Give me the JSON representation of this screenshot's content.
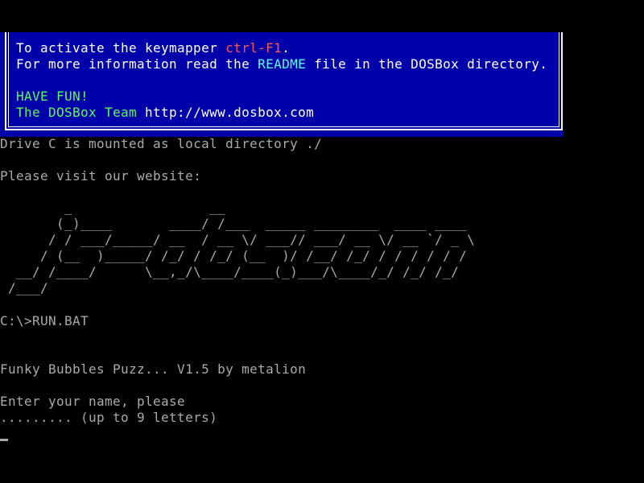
{
  "colors": {
    "background": "#000000",
    "banner_bg": "#0000aa",
    "default_text": "#aaaaaa",
    "bright_white": "#ffffff",
    "highlight_red": "#ff5555",
    "highlight_cyan": "#55ffff",
    "highlight_green": "#55ff55"
  },
  "banner": {
    "line1_prefix": "To activate the keymapper ",
    "line1_key": "ctrl-F1",
    "line1_suffix": ".",
    "line2_prefix": "For more information read the ",
    "line2_file": "README",
    "line2_suffix": " file in the DOSBox directory.",
    "have_fun": "HAVE FUN!",
    "team_label": "The DOSBox Team ",
    "team_url": "http://www.dosbox.com"
  },
  "console": {
    "mount_message": "Drive C is mounted as local directory ./",
    "visit_message": "Please visit our website:",
    "ascii_art": "        _                 __\n       (_)____       ____/ /___  _____ ________  ____ ____\n      / / ___/_____/ __  / __ \\/ ___// ___/ __ \\/ __ `/ _ \\\n     / (__  )_____/ /_/ / /_/ (__  )/ /__/ /_/ / / / / / /\n  __/ /____/      \\__,_/\\____/____(_)___/\\____/_/ /_/ /_/\n /___/",
    "prompt_command": "C:\\>RUN.BAT",
    "game_title": "Funky Bubbles Puzz... V1.5 by metalion",
    "name_prompt": "Enter your name, please",
    "name_hint": "......... (up to 9 letters)"
  }
}
